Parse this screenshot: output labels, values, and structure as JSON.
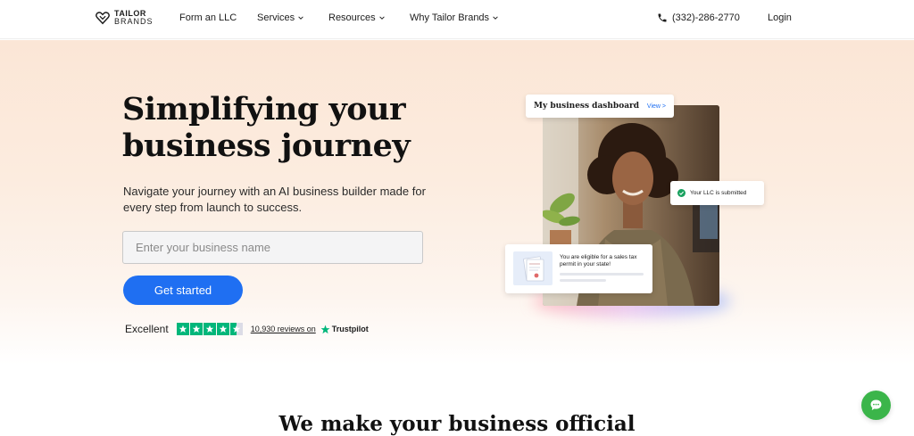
{
  "header": {
    "logo_line1": "TAILOR",
    "logo_line2": "BRANDS",
    "nav": [
      {
        "label": "Form an LLC"
      },
      {
        "label": "Services"
      },
      {
        "label": "Resources"
      },
      {
        "label": "Why Tailor Brands"
      }
    ],
    "phone": "(332)-286-2770",
    "login": "Login"
  },
  "hero": {
    "headline": "Simplifying your business journey",
    "subhead": "Navigate your journey with an AI business builder made for every step from launch to success.",
    "input_placeholder": "Enter your business name",
    "cta": "Get started",
    "rating_label": "Excellent",
    "stars": 4.5,
    "reviews_text": "10,930 reviews on",
    "trustpilot": "Trustpilot"
  },
  "composite": {
    "dashboard_title": "My business dashboard",
    "dashboard_view": "View >",
    "llc_status": "Your LLC is submitted",
    "tax_text": "You are eligible for a sales tax permit in your state!"
  },
  "section": {
    "title": "We make your business official"
  },
  "colors": {
    "accent": "#1f6ff2",
    "trustpilot_green": "#00b67a",
    "chat_green": "#3bb54a",
    "hero_bg": "#fbe6d6"
  },
  "icons": {
    "phone": "phone-icon",
    "chevron": "chevron-down-icon",
    "chat": "chat-icon",
    "check": "check-icon",
    "trustpilot": "trustpilot-star-icon"
  }
}
